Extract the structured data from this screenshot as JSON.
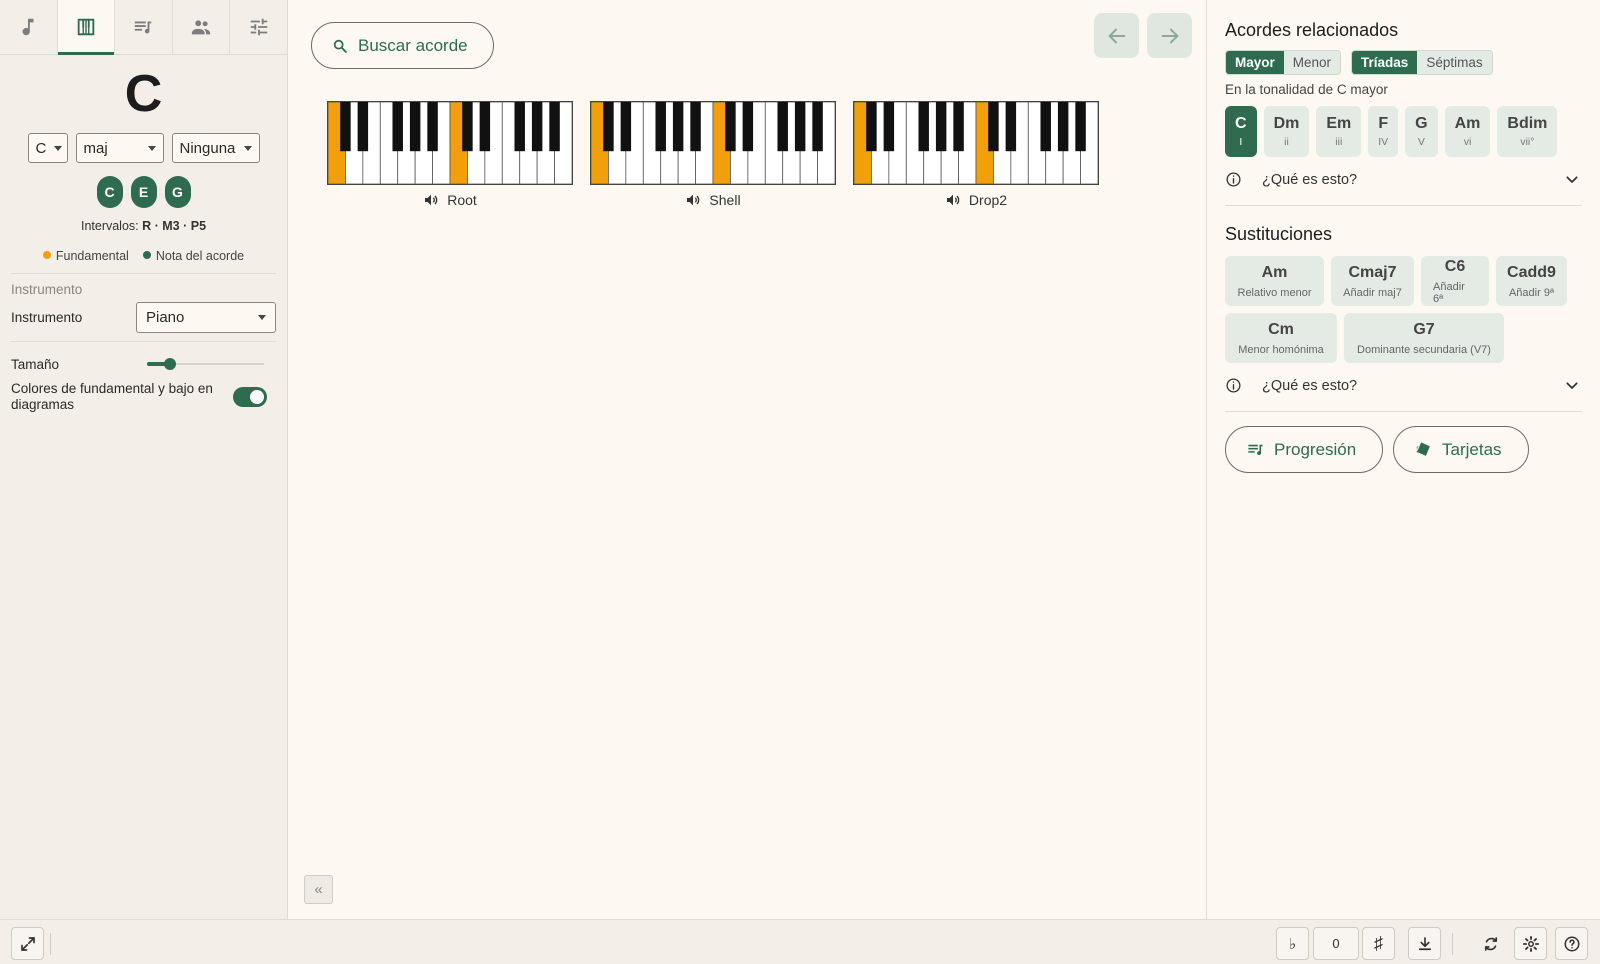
{
  "left_panel": {
    "tabs": [
      "music-note-icon",
      "piano-icon",
      "playlist-icon",
      "people-icon",
      "tune-icon"
    ],
    "chord_name": "C",
    "root": "C",
    "quality": "maj",
    "extension": "Ninguna",
    "notes": [
      "C",
      "E",
      "G"
    ],
    "intervals_label": "Intervalos:",
    "intervals_value": "R · M3 · P5",
    "legend_root": "Fundamental",
    "legend_chord_note": "Nota del acorde",
    "section_instrument": "Instrumento",
    "instrument_label": "Instrumento",
    "instrument_value": "Piano",
    "size_label": "Tamaño",
    "size_fraction": 0.2,
    "colors_label": "Colores de fundamental y bajo en diagramas",
    "colors_enabled": true
  },
  "main": {
    "search_label": "Buscar acorde",
    "voicings": [
      {
        "label": "Root",
        "highlighted_white_keys": [
          0,
          7
        ]
      },
      {
        "label": "Shell",
        "highlighted_white_keys": [
          0,
          7
        ]
      },
      {
        "label": "Drop2",
        "highlighted_white_keys": [
          0,
          7
        ]
      }
    ],
    "collapse_label": "«"
  },
  "right_panel": {
    "related_title": "Acordes relacionados",
    "mode_options": [
      "Mayor",
      "Menor"
    ],
    "mode_selected": "Mayor",
    "type_options": [
      "Tríadas",
      "Séptimas"
    ],
    "type_selected": "Tríadas",
    "tonality": "En la tonalidad de C mayor",
    "diatonic": [
      {
        "chord": "C",
        "degree": "I",
        "active": true
      },
      {
        "chord": "Dm",
        "degree": "ii"
      },
      {
        "chord": "Em",
        "degree": "iii"
      },
      {
        "chord": "F",
        "degree": "IV"
      },
      {
        "chord": "G",
        "degree": "V"
      },
      {
        "chord": "Am",
        "degree": "vi"
      },
      {
        "chord": "Bdim",
        "degree": "vii°"
      }
    ],
    "what_is_this": "¿Qué es esto?",
    "subs_title": "Sustituciones",
    "substitutions": [
      {
        "chord": "Am",
        "desc": "Relativo menor"
      },
      {
        "chord": "Cmaj7",
        "desc": "Añadir maj7"
      },
      {
        "chord": "C6",
        "desc": "Añadir 6ª"
      },
      {
        "chord": "Cadd9",
        "desc": "Añadir 9ª"
      },
      {
        "chord": "Cm",
        "desc": "Menor homónima"
      },
      {
        "chord": "G7",
        "desc": "Dominante secundaria (V7)"
      }
    ],
    "progression_label": "Progresión",
    "cards_label": "Tarjetas"
  },
  "bottom_bar": {
    "flat_label": "♭",
    "transpose_value": "0",
    "sharp_label": "♯"
  },
  "colors": {
    "accent": "#2e6b4f",
    "root_highlight": "#f29f0c",
    "background": "#fdf8f2"
  }
}
